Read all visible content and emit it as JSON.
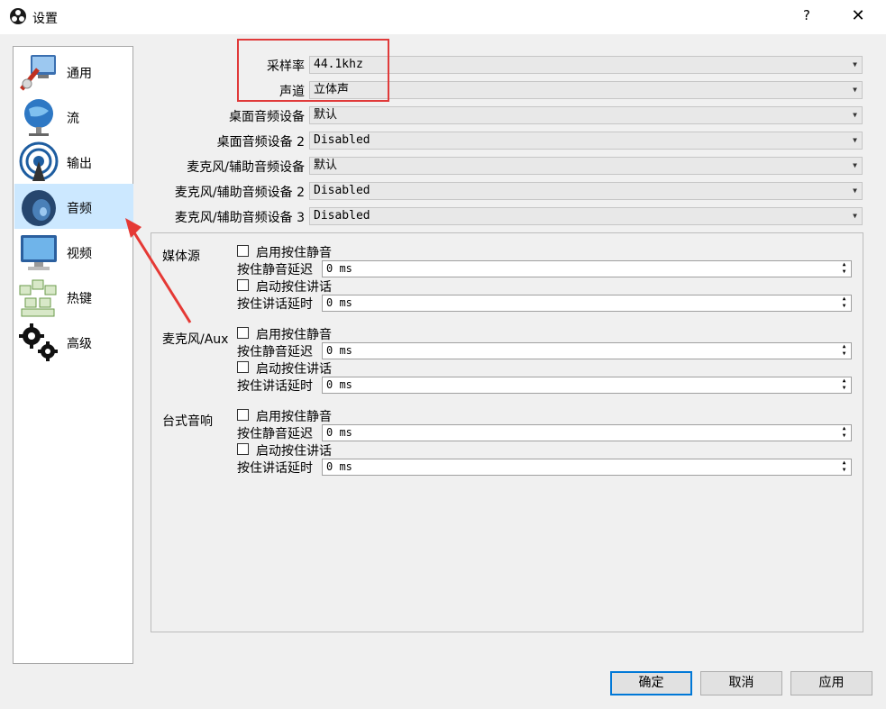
{
  "window": {
    "title": "设置",
    "help": "?",
    "close": "✕"
  },
  "sidebar": {
    "items": [
      {
        "label": "通用",
        "icon": "general-icon"
      },
      {
        "label": "流",
        "icon": "stream-icon"
      },
      {
        "label": "输出",
        "icon": "output-icon"
      },
      {
        "label": "音频",
        "icon": "audio-icon",
        "selected": true
      },
      {
        "label": "视频",
        "icon": "video-icon"
      },
      {
        "label": "热键",
        "icon": "hotkeys-icon"
      },
      {
        "label": "高级",
        "icon": "advanced-icon"
      }
    ]
  },
  "general": {
    "sample_rate": {
      "label": "采样率",
      "value": "44.1khz"
    },
    "channels": {
      "label": "声道",
      "value": "立体声"
    },
    "desktop_audio": {
      "label": "桌面音频设备",
      "value": "默认"
    },
    "desktop_audio_2": {
      "label": "桌面音频设备 2",
      "value": "Disabled"
    },
    "mic_aux": {
      "label": "麦克风/辅助音频设备",
      "value": "默认"
    },
    "mic_aux_2": {
      "label": "麦克风/辅助音频设备 2",
      "value": "Disabled"
    },
    "mic_aux_3": {
      "label": "麦克风/辅助音频设备 3",
      "value": "Disabled"
    }
  },
  "groups": [
    {
      "title": "媒体源",
      "ptm_label": "启用按住静音",
      "ptm_delay_label": "按住静音延迟",
      "ptm_delay_value": "0  ms",
      "ptt_label": "启动按住讲话",
      "ptt_delay_label": "按住讲话延时",
      "ptt_delay_value": "0  ms"
    },
    {
      "title": "麦克风/Aux",
      "ptm_label": "启用按住静音",
      "ptm_delay_label": "按住静音延迟",
      "ptm_delay_value": "0  ms",
      "ptt_label": "启动按住讲话",
      "ptt_delay_label": "按住讲话延时",
      "ptt_delay_value": "0  ms"
    },
    {
      "title": "台式音响",
      "ptm_label": "启用按住静音",
      "ptm_delay_label": "按住静音延迟",
      "ptm_delay_value": "0  ms",
      "ptt_label": "启动按住讲话",
      "ptt_delay_label": "按住讲话延时",
      "ptt_delay_value": "0  ms"
    }
  ],
  "buttons": {
    "ok": "确定",
    "cancel": "取消",
    "apply": "应用"
  },
  "colors": {
    "selected_bg": "#cce8ff",
    "highlight": "#e03a3a",
    "accent": "#0078d7"
  }
}
